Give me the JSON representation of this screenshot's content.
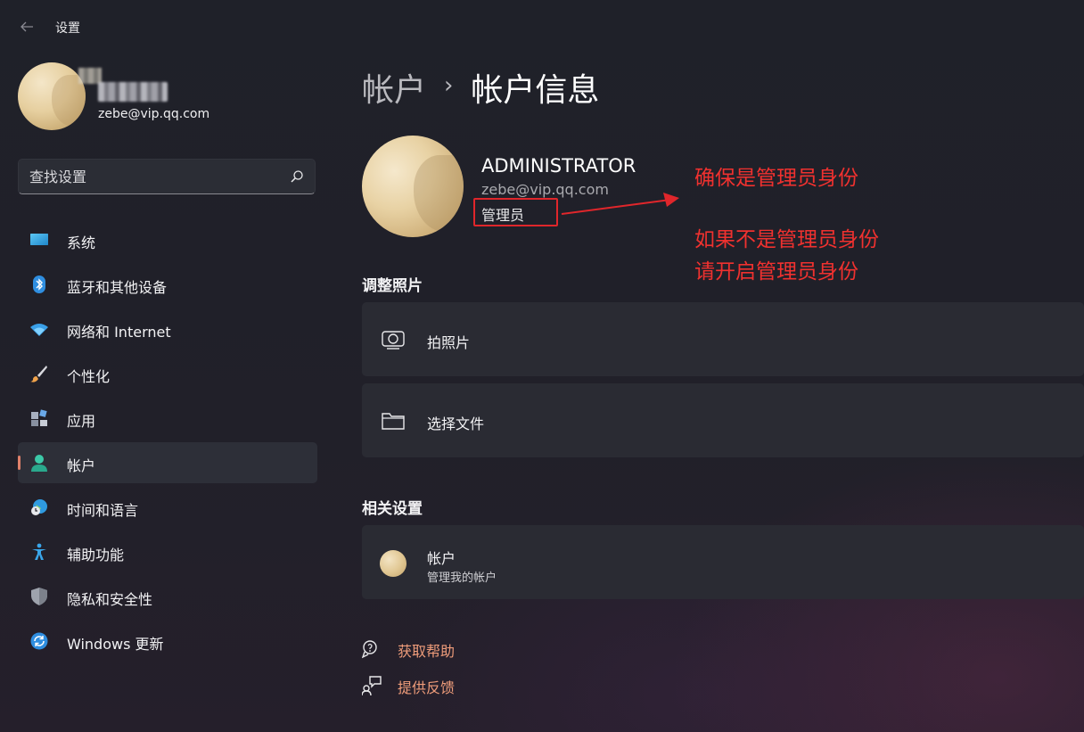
{
  "app": {
    "title": "设置"
  },
  "user": {
    "email": "zebe@vip.qq.com"
  },
  "search": {
    "placeholder": "查找设置"
  },
  "sidebar": {
    "items": [
      {
        "label": "系统",
        "icon": "monitor-icon"
      },
      {
        "label": "蓝牙和其他设备",
        "icon": "bluetooth-icon"
      },
      {
        "label": "网络和 Internet",
        "icon": "wifi-icon"
      },
      {
        "label": "个性化",
        "icon": "brush-icon"
      },
      {
        "label": "应用",
        "icon": "apps-icon"
      },
      {
        "label": "帐户",
        "icon": "account-icon",
        "active": true
      },
      {
        "label": "时间和语言",
        "icon": "globe-clock-icon"
      },
      {
        "label": "辅助功能",
        "icon": "accessibility-icon"
      },
      {
        "label": "隐私和安全性",
        "icon": "shield-icon"
      },
      {
        "label": "Windows 更新",
        "icon": "update-icon"
      }
    ]
  },
  "breadcrumb": {
    "parent": "帐户",
    "separator": "›",
    "current": "帐户信息"
  },
  "profile": {
    "name": "ADMINISTRATOR",
    "email": "zebe@vip.qq.com",
    "role": "管理员"
  },
  "annotations": {
    "line1": "确保是管理员身份",
    "line2": "如果不是管理员身份",
    "line3": "请开启管理员身份",
    "color": "#f0312f"
  },
  "adjust_photo": {
    "title": "调整照片",
    "take_photo": "拍照片",
    "choose_file": "选择文件"
  },
  "related": {
    "title": "相关设置",
    "account_title": "帐户",
    "account_subtitle": "管理我的帐户"
  },
  "links": {
    "help": "获取帮助",
    "feedback": "提供反馈",
    "color": "#ee9c7a"
  },
  "colors": {
    "accent": "#e0806a",
    "background": "#20202a",
    "card": "#2a2b33"
  }
}
